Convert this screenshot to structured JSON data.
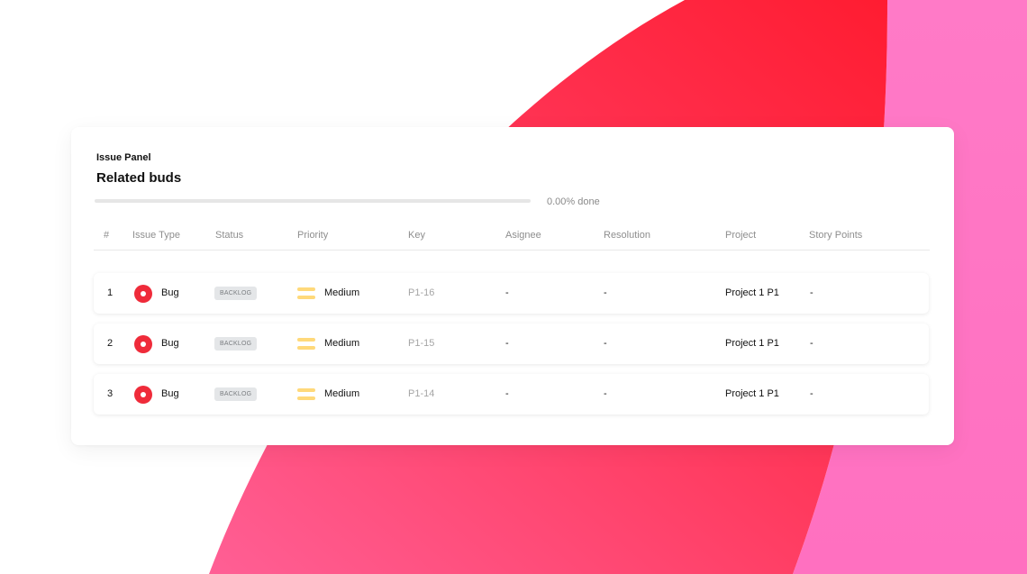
{
  "panel": {
    "label": "Issue Panel",
    "title": "Related buds",
    "progress": {
      "fraction": 0.0,
      "text": "0.00% done",
      "color": "#ff3b5c"
    }
  },
  "table": {
    "headers": [
      "#",
      "Issue Type",
      "Status",
      "Priority",
      "Key",
      "Asignee",
      "Resolution",
      "Project",
      "Story Points"
    ],
    "rows": [
      {
        "num": "1",
        "type": "Bug",
        "type_icon": "bug-icon",
        "status": "BACKLOG",
        "priority": "Medium",
        "priority_icon": "priority-medium-icon",
        "key": "P1-16",
        "assignee": "-",
        "resolution": "-",
        "project": "Project 1 P1",
        "points": "-"
      },
      {
        "num": "2",
        "type": "Bug",
        "type_icon": "bug-icon",
        "status": "BACKLOG",
        "priority": "Medium",
        "priority_icon": "priority-medium-icon",
        "key": "P1-15",
        "assignee": "-",
        "resolution": "-",
        "project": "Project 1 P1",
        "points": "-"
      },
      {
        "num": "3",
        "type": "Bug",
        "type_icon": "bug-icon",
        "status": "BACKLOG",
        "priority": "Medium",
        "priority_icon": "priority-medium-icon",
        "key": "P1-14",
        "assignee": "-",
        "resolution": "-",
        "project": "Project 1 P1",
        "points": "-"
      }
    ]
  },
  "colors": {
    "bug": "#ef2b3a",
    "priority_medium": "#ffd97a",
    "badge_bg": "#e4e6e8",
    "bg_red": "#ff2437",
    "bg_pink": "#ff78c8"
  }
}
